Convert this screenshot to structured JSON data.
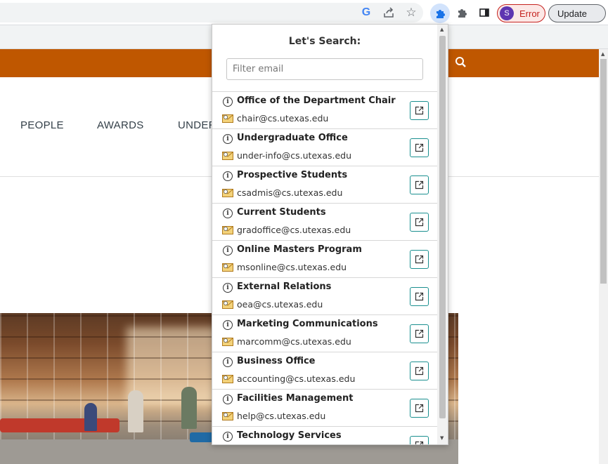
{
  "browser": {
    "profile_initial": "S",
    "profile_status": "Error",
    "update_label": "Update"
  },
  "site": {
    "nav": [
      "PEOPLE",
      "AWARDS",
      "UNDER"
    ],
    "accent_color": "#bf5700"
  },
  "popup": {
    "title": "Let's Search:",
    "filter_placeholder": "Filter email",
    "filter_value": "",
    "contacts": [
      {
        "name": "Office of the Department Chair",
        "email": "chair@cs.utexas.edu"
      },
      {
        "name": "Undergraduate Office",
        "email": "under-info@cs.utexas.edu"
      },
      {
        "name": "Prospective Students",
        "email": "csadmis@cs.utexas.edu"
      },
      {
        "name": "Current Students",
        "email": "gradoffice@cs.utexas.edu"
      },
      {
        "name": "Online Masters Program",
        "email": "msonline@cs.utexas.edu"
      },
      {
        "name": "External Relations",
        "email": "oea@cs.utexas.edu"
      },
      {
        "name": "Marketing Communications",
        "email": "marcomm@cs.utexas.edu"
      },
      {
        "name": "Business Office",
        "email": "accounting@cs.utexas.edu"
      },
      {
        "name": "Facilities Management",
        "email": "help@cs.utexas.edu"
      },
      {
        "name": "Technology Services",
        "email": ""
      }
    ],
    "icons": {
      "info": "info-icon",
      "mail": "envelope-icon",
      "open": "external-link-icon"
    }
  }
}
